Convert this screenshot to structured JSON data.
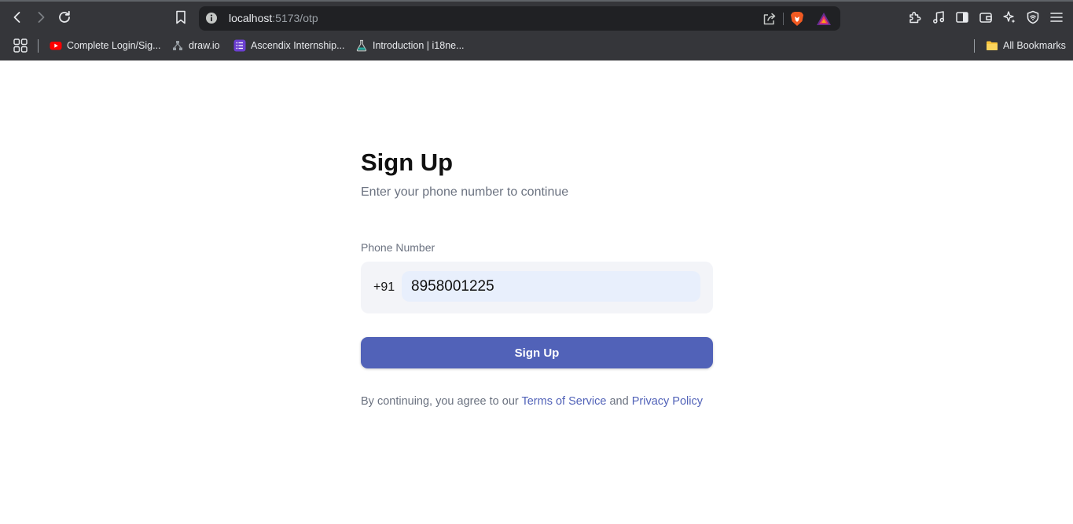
{
  "browser": {
    "url_host": "localhost",
    "url_path": ":5173/otp",
    "bookmarks": [
      {
        "label": "Complete Login/Sig...",
        "icon": "youtube-icon"
      },
      {
        "label": "draw.io",
        "icon": "drawio-icon"
      },
      {
        "label": "Ascendix Internship...",
        "icon": "list-icon"
      },
      {
        "label": "Introduction | i18ne...",
        "icon": "flask-icon"
      }
    ],
    "all_bookmarks_label": "All Bookmarks"
  },
  "signup": {
    "title": "Sign Up",
    "subtitle": "Enter your phone number to continue",
    "phone_label": "Phone Number",
    "country_code": "+91",
    "phone_value": "8958001225",
    "submit_label": "Sign Up",
    "terms_prefix": "By continuing, you agree to our ",
    "terms_link": "Terms of Service",
    "terms_and": " and ",
    "privacy_link": "Privacy Policy"
  },
  "colors": {
    "accent": "#5162b8",
    "input_bg": "#e8effc",
    "box_bg": "#f3f4f8",
    "muted_text": "#6b7280"
  }
}
